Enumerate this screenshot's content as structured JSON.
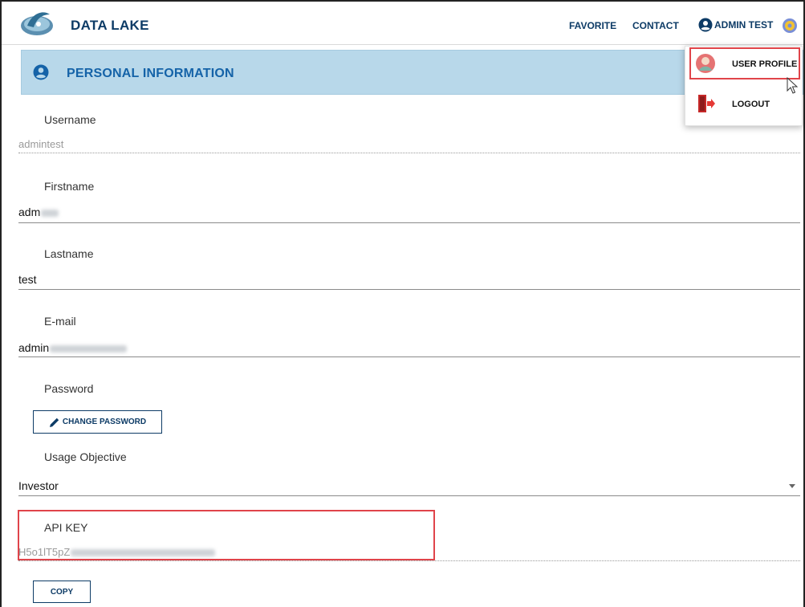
{
  "header": {
    "brand": "DATA LAKE",
    "nav": {
      "favorite": "FAVORITE",
      "contact": "CONTACT",
      "user": "ADMIN TEST"
    }
  },
  "user_menu": {
    "items": [
      {
        "label": "USER PROFILE",
        "icon": "user-avatar-icon"
      },
      {
        "label": "LOGOUT",
        "icon": "door-exit-icon"
      }
    ]
  },
  "section": {
    "title": "PERSONAL INFORMATION",
    "icon": "account-circle-icon"
  },
  "form": {
    "username": {
      "label": "Username",
      "value": "admintest"
    },
    "firstname": {
      "label": "Firstname",
      "value": "adm"
    },
    "lastname": {
      "label": "Lastname",
      "value": "test"
    },
    "email": {
      "label": "E-mail",
      "value": "admin"
    },
    "password": {
      "label": "Password",
      "button": "CHANGE PASSWORD"
    },
    "usage_objective": {
      "label": "Usage Objective",
      "value": "Investor"
    },
    "api_key": {
      "label": "API KEY",
      "value": "H5o1lT5pZ",
      "button": "COPY"
    }
  },
  "colors": {
    "brand": "#0d3b66",
    "section_header_bg": "#b8d8ea",
    "section_title": "#1563a8",
    "highlight": "#e0444a"
  }
}
